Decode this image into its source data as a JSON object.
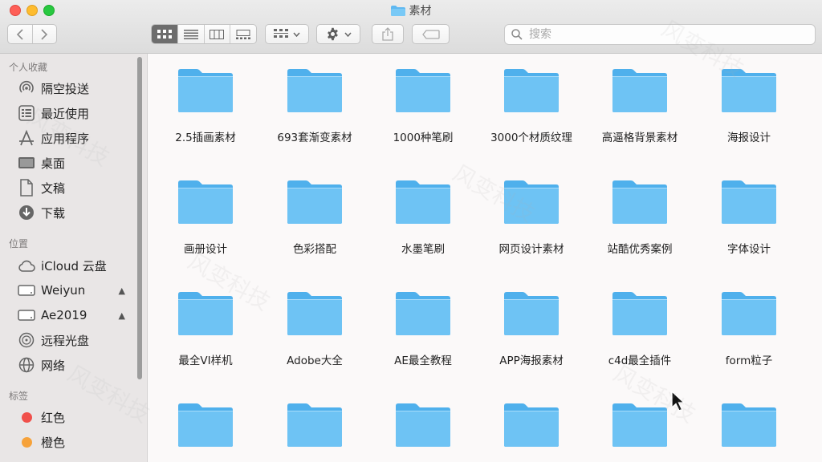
{
  "window": {
    "title": "素材"
  },
  "toolbar": {
    "back_icon": "chevron-left-icon",
    "forward_icon": "chevron-right-icon",
    "view_modes": [
      "icon-view-icon",
      "list-view-icon",
      "column-view-icon",
      "gallery-view-icon"
    ],
    "search_placeholder": "搜索"
  },
  "sidebar": {
    "favorites_title": "个人收藏",
    "favorites": [
      {
        "label": "隔空投送",
        "icon": "airdrop-icon"
      },
      {
        "label": "最近使用",
        "icon": "recents-icon"
      },
      {
        "label": "应用程序",
        "icon": "applications-icon"
      },
      {
        "label": "桌面",
        "icon": "desktop-icon"
      },
      {
        "label": "文稿",
        "icon": "documents-icon"
      },
      {
        "label": "下载",
        "icon": "downloads-icon"
      }
    ],
    "locations_title": "位置",
    "locations": [
      {
        "label": "iCloud 云盘",
        "icon": "icloud-icon"
      },
      {
        "label": "Weiyun",
        "icon": "drive-icon",
        "eject": true
      },
      {
        "label": "Ae2019",
        "icon": "drive-icon",
        "eject": true
      },
      {
        "label": "远程光盘",
        "icon": "disc-icon"
      },
      {
        "label": "网络",
        "icon": "network-icon"
      }
    ],
    "tags_title": "标签",
    "tags": [
      {
        "label": "红色",
        "color": "#f0504b"
      },
      {
        "label": "橙色",
        "color": "#f6a23a"
      }
    ]
  },
  "folders": [
    "2.5插画素材",
    "693套渐变素材",
    "1000种笔刷",
    "3000个材质纹理",
    "高逼格背景素材",
    "海报设计",
    "画册设计",
    "色彩搭配",
    "水墨笔刷",
    "网页设计素材",
    "站酷优秀案例",
    "字体设计",
    "最全VI样机",
    "Adobe大全",
    "AE最全教程",
    "APP海报素材",
    "c4d最全插件",
    "form粒子",
    "",
    "",
    "",
    "",
    "",
    ""
  ],
  "colors": {
    "folder_front": "#6ec3f4",
    "folder_back": "#4fb0ec"
  }
}
